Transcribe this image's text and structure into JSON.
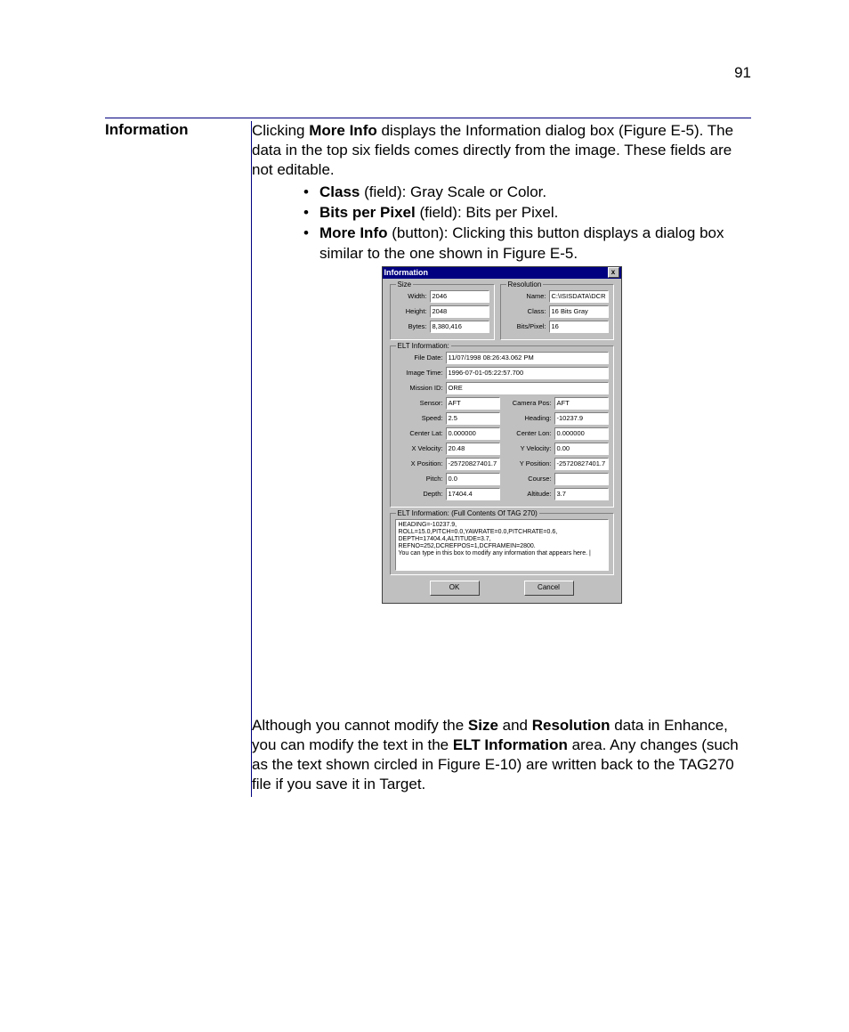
{
  "page_number": "91",
  "heading": "Information",
  "para1_parts": {
    "p1a": "Clicking ",
    "p1b": "More Info",
    "p1c": " displays the Information dialog box (Figure E-5). The data in the top six fields comes directly from the image. These fields are not editable."
  },
  "bullets": [
    {
      "bold": "Class",
      "rest": " (field): Gray Scale or Color."
    },
    {
      "bold": "Bits per Pixel",
      "rest": " (field): Bits per Pixel."
    },
    {
      "bold": "More Info",
      "rest": " (button): Clicking this button displays a dialog box similar to the one shown in Figure E-5."
    }
  ],
  "para2_parts": {
    "a": "Although you cannot modify the ",
    "b": "Size",
    "c": " and ",
    "d": "Resolution",
    "e": " data in Enhance, you can modify the text in the ",
    "f": "ELT Information",
    "g": " area. Any changes (such as the text shown circled in Figure E-10) are written back to the TAG270 file if you save it in Target."
  },
  "dialog": {
    "title": "Information",
    "close": "x",
    "size_legend": "Size",
    "res_legend": "Resolution",
    "width_label": "Width:",
    "width_val": "2046",
    "height_label": "Height:",
    "height_val": "2048",
    "bytes_label": "Bytes:",
    "bytes_val": " 8,380,416",
    "name_label": "Name:",
    "name_val": "C:\\ISISDATA\\DCR",
    "class_label": "Class:",
    "class_val": "16 Bits Gray",
    "bpp_label": "Bits/Pixel:",
    "bpp_val": "16",
    "elt_legend": "ELT Information:",
    "file_date_label": "File Date:",
    "file_date_val": "11/07/1998 08:26:43.062 PM",
    "image_time_label": "Image Time:",
    "image_time_val": "1996-07-01-05:22:57.700",
    "mission_id_label": "Mission ID:",
    "mission_id_val": "ORE",
    "sensor_label": "Sensor:",
    "sensor_val": "AFT",
    "camera_pos_label": "Camera Pos:",
    "camera_pos_val": "AFT",
    "speed_label": "Speed:",
    "speed_val": "2.5",
    "heading_label": "Heading:",
    "heading_val": "-10237.9",
    "center_lat_label": "Center Lat:",
    "center_lat_val": "0.000000",
    "center_lon_label": "Center Lon:",
    "center_lon_val": "0.000000",
    "xvel_label": "X Velocity:",
    "xvel_val": "20.48",
    "yvel_label": "Y Velocity:",
    "yvel_val": "0.00",
    "xpos_label": "X Position:",
    "xpos_val": "-25720827401.7",
    "ypos_label": "Y Position:",
    "ypos_val": "-25720827401.7",
    "pitch_label": "Pitch:",
    "pitch_val": "0.0",
    "course_label": "Course:",
    "course_val": "",
    "depth_label": "Depth:",
    "depth_val": "17404.4",
    "altitude_label": "Altitude:",
    "altitude_val": "3.7",
    "full_legend": "ELT Information:  (Full Contents Of TAG 270)",
    "full_text": "HEADING=-10237.9,\nROLL=15.0,PITCH=0.0,YAWRATE=0.0,PITCHRATE=0.6,\nDEPTH=17404.4,ALTITUDE=3.7,\nREFNO=252,DCREFPOS=1,DCFRAMEIN=2800.\nYou can type in this box to modify any information that appears here. |",
    "ok": "OK",
    "cancel": "Cancel"
  }
}
